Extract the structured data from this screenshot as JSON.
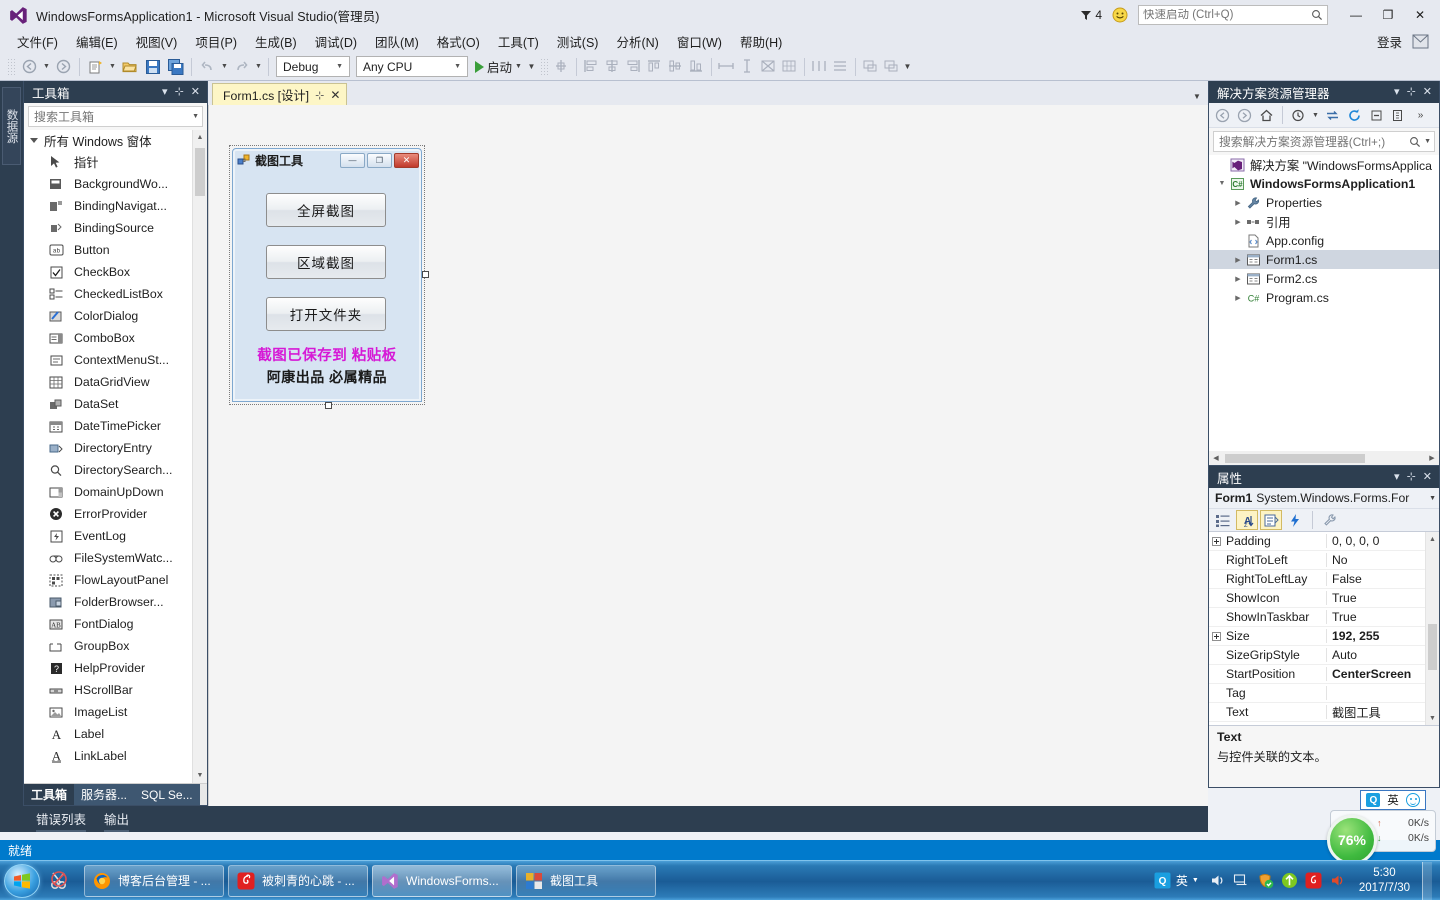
{
  "window": {
    "title": "WindowsFormsApplication1 - Microsoft Visual Studio(管理员)",
    "notification_count": "4",
    "minimize": "—",
    "restore": "❐",
    "close": "✕"
  },
  "quick_launch": {
    "placeholder": "快速启动 (Ctrl+Q)",
    "value": ""
  },
  "menu": {
    "items": [
      {
        "label": "文件(F)"
      },
      {
        "label": "编辑(E)"
      },
      {
        "label": "视图(V)"
      },
      {
        "label": "项目(P)"
      },
      {
        "label": "生成(B)"
      },
      {
        "label": "调试(D)"
      },
      {
        "label": "团队(M)"
      },
      {
        "label": "格式(O)"
      },
      {
        "label": "工具(T)"
      },
      {
        "label": "测试(S)"
      },
      {
        "label": "分析(N)"
      },
      {
        "label": "窗口(W)"
      },
      {
        "label": "帮助(H)"
      }
    ],
    "signin_label": "登录"
  },
  "toolbar": {
    "configuration": "Debug",
    "platform": "Any CPU",
    "start_label": "启动"
  },
  "left_edge": {
    "vertical_tab": "数据源"
  },
  "toolbox": {
    "title": "工具箱",
    "search_placeholder": "搜索工具箱",
    "group": "所有 Windows 窗体",
    "items": [
      {
        "label": "指针",
        "icon": "pointer-icon"
      },
      {
        "label": "BackgroundWo...",
        "icon": "backgroundworker-icon"
      },
      {
        "label": "BindingNavigat...",
        "icon": "bindingnavigator-icon"
      },
      {
        "label": "BindingSource",
        "icon": "bindingsource-icon"
      },
      {
        "label": "Button",
        "icon": "button-icon"
      },
      {
        "label": "CheckBox",
        "icon": "checkbox-icon"
      },
      {
        "label": "CheckedListBox",
        "icon": "checkedlistbox-icon"
      },
      {
        "label": "ColorDialog",
        "icon": "colordialog-icon"
      },
      {
        "label": "ComboBox",
        "icon": "combobox-icon"
      },
      {
        "label": "ContextMenuSt...",
        "icon": "contextmenustrip-icon"
      },
      {
        "label": "DataGridView",
        "icon": "datagridview-icon"
      },
      {
        "label": "DataSet",
        "icon": "dataset-icon"
      },
      {
        "label": "DateTimePicker",
        "icon": "datetimepicker-icon"
      },
      {
        "label": "DirectoryEntry",
        "icon": "directoryentry-icon"
      },
      {
        "label": "DirectorySearch...",
        "icon": "directorysearcher-icon"
      },
      {
        "label": "DomainUpDown",
        "icon": "domainupdown-icon"
      },
      {
        "label": "ErrorProvider",
        "icon": "errorprovider-icon"
      },
      {
        "label": "EventLog",
        "icon": "eventlog-icon"
      },
      {
        "label": "FileSystemWatc...",
        "icon": "filesystemwatcher-icon"
      },
      {
        "label": "FlowLayoutPanel",
        "icon": "flowlayoutpanel-icon"
      },
      {
        "label": "FolderBrowser...",
        "icon": "folderbrowser-icon"
      },
      {
        "label": "FontDialog",
        "icon": "fontdialog-icon"
      },
      {
        "label": "GroupBox",
        "icon": "groupbox-icon"
      },
      {
        "label": "HelpProvider",
        "icon": "helpprovider-icon"
      },
      {
        "label": "HScrollBar",
        "icon": "hscrollbar-icon"
      },
      {
        "label": "ImageList",
        "icon": "imagelist-icon"
      },
      {
        "label": "Label",
        "icon": "label-icon"
      },
      {
        "label": "LinkLabel",
        "icon": "linklabel-icon"
      }
    ],
    "bottom_tabs": [
      {
        "label": "工具箱",
        "active": true
      },
      {
        "label": "服务器...",
        "active": false
      },
      {
        "label": "SQL Se...",
        "active": false
      }
    ]
  },
  "document": {
    "tab_label": "Form1.cs [设计]",
    "pin": "⊹",
    "close": "✕"
  },
  "designer_form": {
    "title": "截图工具",
    "minimize": "—",
    "maximize": "❐",
    "close": "✕",
    "buttons": [
      {
        "label": "全屏截图"
      },
      {
        "label": "区域截图"
      },
      {
        "label": "打开文件夹"
      }
    ],
    "label_primary": "截图已保存到 粘贴板",
    "label_secondary": "阿康出品 必属精品",
    "label_primary_color": "#d619d6"
  },
  "bottom_panel_tabs": [
    {
      "label": "错误列表"
    },
    {
      "label": "输出"
    }
  ],
  "solution_explorer": {
    "title": "解决方案资源管理器",
    "search_placeholder": "搜索解决方案资源管理器(Ctrl+;)",
    "tree": [
      {
        "label": "解决方案 \"WindowsFormsApplica",
        "indent": 0,
        "expander": "",
        "icon": "solution-icon",
        "bold": false,
        "selected": false
      },
      {
        "label": "WindowsFormsApplication1",
        "indent": 0,
        "expander": "▼",
        "icon": "csproject-icon",
        "bold": true,
        "selected": false
      },
      {
        "label": "Properties",
        "indent": 1,
        "expander": "▶",
        "icon": "wrench-icon",
        "bold": false,
        "selected": false
      },
      {
        "label": "引用",
        "indent": 1,
        "expander": "▶",
        "icon": "references-icon",
        "bold": false,
        "selected": false
      },
      {
        "label": "App.config",
        "indent": 1,
        "expander": "",
        "icon": "config-icon",
        "bold": false,
        "selected": false
      },
      {
        "label": "Form1.cs",
        "indent": 1,
        "expander": "▶",
        "icon": "form-icon",
        "bold": false,
        "selected": true
      },
      {
        "label": "Form2.cs",
        "indent": 1,
        "expander": "▶",
        "icon": "form-icon",
        "bold": false,
        "selected": false
      },
      {
        "label": "Program.cs",
        "indent": 1,
        "expander": "▶",
        "icon": "csfile-icon",
        "bold": false,
        "selected": false
      }
    ]
  },
  "properties": {
    "title": "属性",
    "object_name": "Form1",
    "object_type": "System.Windows.Forms.For",
    "rows": [
      {
        "name": "Padding",
        "value": "0, 0, 0, 0",
        "expandable": true,
        "bold": false
      },
      {
        "name": "RightToLeft",
        "value": "No",
        "expandable": false,
        "bold": false
      },
      {
        "name": "RightToLeftLay",
        "value": "False",
        "expandable": false,
        "bold": false
      },
      {
        "name": "ShowIcon",
        "value": "True",
        "expandable": false,
        "bold": false
      },
      {
        "name": "ShowInTaskbar",
        "value": "True",
        "expandable": false,
        "bold": false
      },
      {
        "name": "Size",
        "value": "192, 255",
        "expandable": true,
        "bold": true
      },
      {
        "name": "SizeGripStyle",
        "value": "Auto",
        "expandable": false,
        "bold": false
      },
      {
        "name": "StartPosition",
        "value": "CenterScreen",
        "expandable": false,
        "bold": true
      },
      {
        "name": "Tag",
        "value": "",
        "expandable": false,
        "bold": false
      },
      {
        "name": "Text",
        "value": "截图工具",
        "expandable": false,
        "bold": false
      }
    ],
    "description_title": "Text",
    "description_body": "与控件关联的文本。"
  },
  "status_bar": {
    "text": "就绪"
  },
  "ime_float": {
    "engine": "Q",
    "language": "英",
    "face": "☺"
  },
  "net_widget": {
    "percent": "76%",
    "upload": "0K/s",
    "download": "0K/s",
    "up_arrow": "↑",
    "down_arrow": "↓"
  },
  "taskbar": {
    "items": [
      {
        "label": "博客后台管理 - ...",
        "icon": "firefox-icon",
        "active": false
      },
      {
        "label": "被刺青的心跳 - ...",
        "icon": "netease-music-icon",
        "active": false
      },
      {
        "label": "WindowsForms...",
        "icon": "visualstudio-icon",
        "active": true
      },
      {
        "label": "截图工具",
        "icon": "screenshot-tool-icon",
        "active": false
      }
    ],
    "tray": {
      "language": "英",
      "time": "5:30",
      "date": "2017/7/30"
    }
  }
}
